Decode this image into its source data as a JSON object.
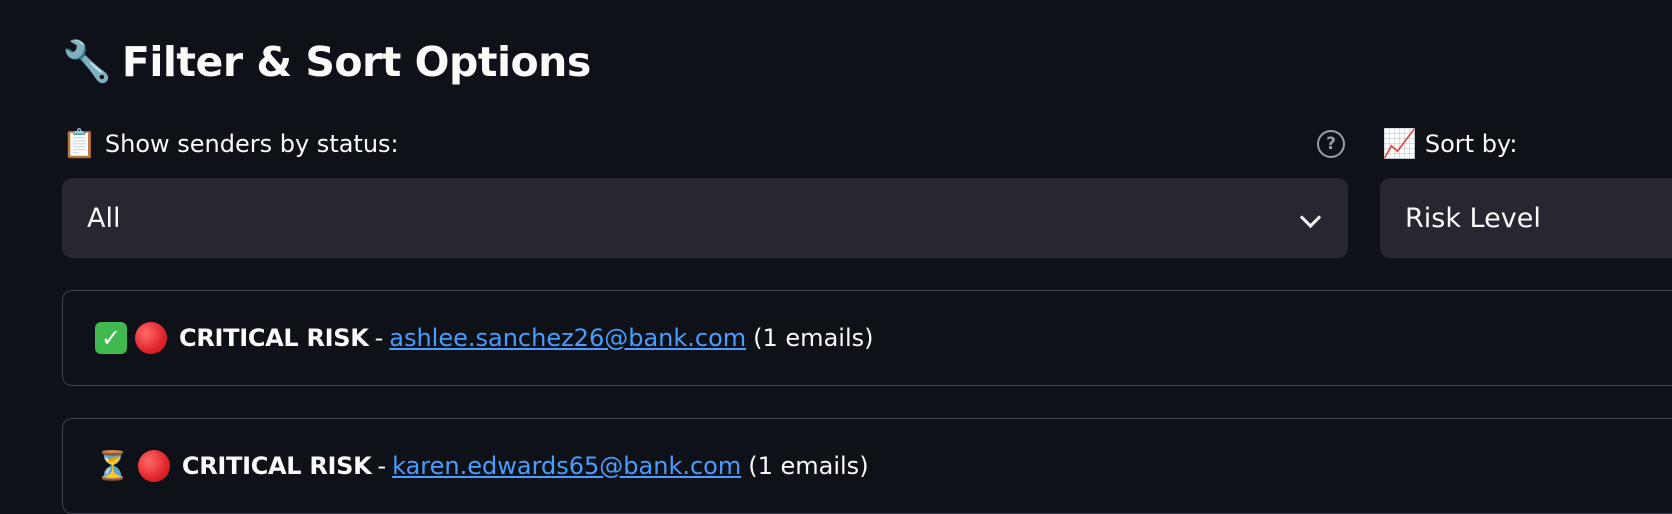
{
  "heading": {
    "icon": "🔧",
    "text": "Filter & Sort Options"
  },
  "status_filter": {
    "icon": "📋",
    "label": "Show senders by status:",
    "help_icon": "?",
    "selected": "All"
  },
  "sort": {
    "icon": "📈",
    "label": "Sort by:",
    "selected": "Risk Level"
  },
  "senders": [
    {
      "status_icon": "✓",
      "risk_label": "CRITICAL RISK",
      "separator": "-",
      "email": "ashlee.sanchez26@bank.com",
      "count": "(1 emails)"
    },
    {
      "status_icon": "⏳",
      "risk_label": "CRITICAL RISK",
      "separator": "-",
      "email": "karen.edwards65@bank.com",
      "count": "(1 emails)"
    }
  ],
  "colors": {
    "background": "#0e1117",
    "select_bg": "#262730",
    "link": "#4a9dff",
    "critical": "#e0242b",
    "done": "#3fb950"
  }
}
